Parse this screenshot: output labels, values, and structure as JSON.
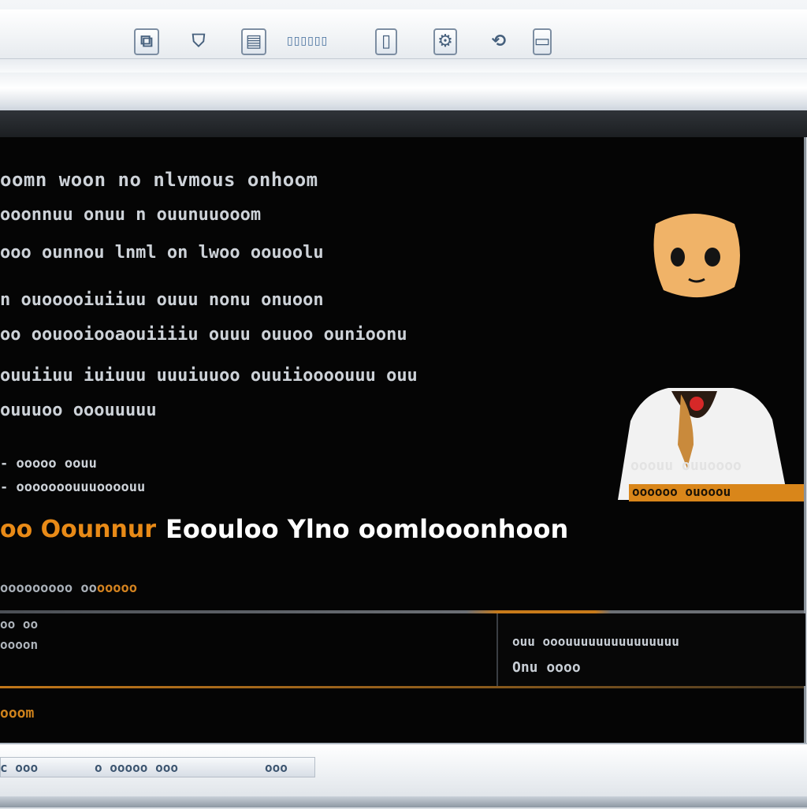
{
  "toolbar": {
    "label": "▯▯▯▯▯▯"
  },
  "content": {
    "lines": [
      "oomn woon no nlvmous onhoom",
      "ooonnuu onuu n ouunuuooom",
      "ooo ounnou lnml on lwoo oouoolu",
      "n ouooooiuiiuu ouuu nonu onuoon",
      "oo oouooiooaouiiiiu ouuu ouuoo ounioonu",
      "ouuiiuu iuiuuu uuuiuuoo ouuiioooouuu ouu",
      "ouuuoo ooouuuuu"
    ],
    "small_lines": [
      "- ooooo oouu",
      "- ooooooouuuoooouu"
    ],
    "headline_accent": "oo Oounnur",
    "headline_main": "Eoouloo Ylno oomlooonhoon",
    "bar_text": "ooooooooo oo",
    "bar_accent": "ooooo",
    "row_small_a": "oo oo",
    "row_small_b": "oooon",
    "sub_panel_row1": "ouu ooouuuuuuuuuuuuuuu",
    "sub_panel_row2": "Onu oooo",
    "footer": "ooom",
    "caption_line1": "ooouu ouuoooo",
    "caption_line2": "oooooo ouooou"
  },
  "status": {
    "left": "c ooo",
    "middle": "o ooooo ooo",
    "right": "ooo"
  },
  "colors": {
    "background": "#050505",
    "accent": "#e88a17",
    "text": "#cdd2d8",
    "chrome": "#e9edf1"
  },
  "icons": [
    "copy-icon",
    "shield-icon",
    "document-icon",
    "page-icon",
    "gear-icon",
    "refresh-icon",
    "folder-icon"
  ]
}
